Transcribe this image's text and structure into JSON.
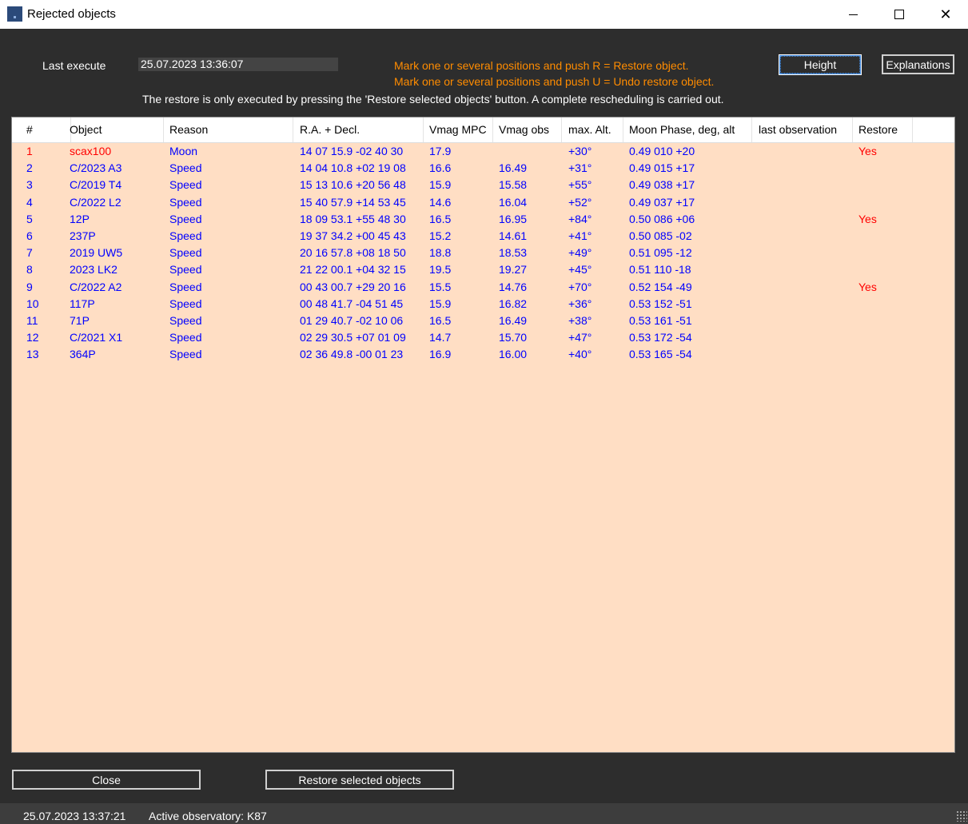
{
  "window": {
    "title": "Rejected objects"
  },
  "header": {
    "last_execute_label": "Last execute",
    "last_execute_value": "25.07.2023 13:36:07",
    "hint1": "Mark one or several positions and push R = Restore object.",
    "hint2": "Mark one or several positions and push U = Undo restore object.",
    "note": "The restore is only executed by pressing the 'Restore selected objects' button. A complete rescheduling is carried out.",
    "height_button": "Height",
    "explanations_button": "Explanations"
  },
  "table": {
    "columns": [
      "#",
      "Object",
      "Reason",
      "R.A. + Decl.",
      "Vmag MPC",
      "Vmag obs",
      "max. Alt.",
      "Moon Phase, deg, alt",
      "last observation",
      "Restore"
    ],
    "rows": [
      {
        "num": "1",
        "object": "scax100",
        "reason": "Moon",
        "radec": "14 07 15.9 -02 40 30",
        "vmag_mpc": "17.9",
        "vmag_obs": "",
        "max_alt": "+30°",
        "moon": "0.49  010  +20",
        "last_obs": "",
        "restore": "Yes",
        "highlight": true
      },
      {
        "num": "2",
        "object": "C/2023 A3",
        "reason": "Speed",
        "radec": "14 04 10.8 +02 19 08",
        "vmag_mpc": "16.6",
        "vmag_obs": "16.49",
        "max_alt": "+31°",
        "moon": "0.49  015  +17",
        "last_obs": "",
        "restore": ""
      },
      {
        "num": "3",
        "object": "C/2019 T4",
        "reason": "Speed",
        "radec": "15 13 10.6 +20 56 48",
        "vmag_mpc": "15.9",
        "vmag_obs": "15.58",
        "max_alt": "+55°",
        "moon": "0.49  038  +17",
        "last_obs": "",
        "restore": ""
      },
      {
        "num": "4",
        "object": "C/2022 L2",
        "reason": "Speed",
        "radec": "15 40 57.9 +14 53 45",
        "vmag_mpc": "14.6",
        "vmag_obs": "16.04",
        "max_alt": "+52°",
        "moon": "0.49  037  +17",
        "last_obs": "",
        "restore": ""
      },
      {
        "num": "5",
        "object": "12P",
        "reason": "Speed",
        "radec": "18 09 53.1 +55 48 30",
        "vmag_mpc": "16.5",
        "vmag_obs": "16.95",
        "max_alt": "+84°",
        "moon": "0.50  086  +06",
        "last_obs": "",
        "restore": "Yes"
      },
      {
        "num": "6",
        "object": "237P",
        "reason": "Speed",
        "radec": "19 37 34.2 +00 45 43",
        "vmag_mpc": "15.2",
        "vmag_obs": "14.61",
        "max_alt": "+41°",
        "moon": "0.50  085  -02",
        "last_obs": "",
        "restore": ""
      },
      {
        "num": "7",
        "object": "2019 UW5",
        "reason": "Speed",
        "radec": "20 16 57.8 +08 18 50",
        "vmag_mpc": "18.8",
        "vmag_obs": "18.53",
        "max_alt": "+49°",
        "moon": "0.51  095  -12",
        "last_obs": "",
        "restore": ""
      },
      {
        "num": "8",
        "object": "2023 LK2",
        "reason": "Speed",
        "radec": "21 22 00.1 +04 32 15",
        "vmag_mpc": "19.5",
        "vmag_obs": "19.27",
        "max_alt": "+45°",
        "moon": "0.51  110  -18",
        "last_obs": "",
        "restore": ""
      },
      {
        "num": "9",
        "object": "C/2022 A2",
        "reason": "Speed",
        "radec": "00 43 00.7 +29 20 16",
        "vmag_mpc": "15.5",
        "vmag_obs": "14.76",
        "max_alt": "+70°",
        "moon": "0.52  154  -49",
        "last_obs": "",
        "restore": "Yes"
      },
      {
        "num": "10",
        "object": "117P",
        "reason": "Speed",
        "radec": "00 48 41.7 -04 51 45",
        "vmag_mpc": "15.9",
        "vmag_obs": "16.82",
        "max_alt": "+36°",
        "moon": "0.53  152  -51",
        "last_obs": "",
        "restore": ""
      },
      {
        "num": "11",
        "object": "71P",
        "reason": "Speed",
        "radec": "01 29 40.7 -02 10 06",
        "vmag_mpc": "16.5",
        "vmag_obs": "16.49",
        "max_alt": "+38°",
        "moon": "0.53  161  -51",
        "last_obs": "",
        "restore": ""
      },
      {
        "num": "12",
        "object": "C/2021 X1",
        "reason": "Speed",
        "radec": "02 29 30.5 +07 01 09",
        "vmag_mpc": "14.7",
        "vmag_obs": "15.70",
        "max_alt": "+47°",
        "moon": "0.53  172  -54",
        "last_obs": "",
        "restore": ""
      },
      {
        "num": "13",
        "object": "364P",
        "reason": "Speed",
        "radec": "02 36 49.8 -00 01 23",
        "vmag_mpc": "16.9",
        "vmag_obs": "16.00",
        "max_alt": "+40°",
        "moon": "0.53  165  -54",
        "last_obs": "",
        "restore": ""
      }
    ]
  },
  "footer": {
    "close_button": "Close",
    "restore_button": "Restore selected objects"
  },
  "status": {
    "datetime": "25.07.2023 13:37:21",
    "observatory": "Active observatory: K87"
  },
  "colors": {
    "row_text": "#0000ff",
    "highlight_text": "#ff0000",
    "hint_text": "#ff8c00",
    "table_bg": "#ffdec4"
  }
}
